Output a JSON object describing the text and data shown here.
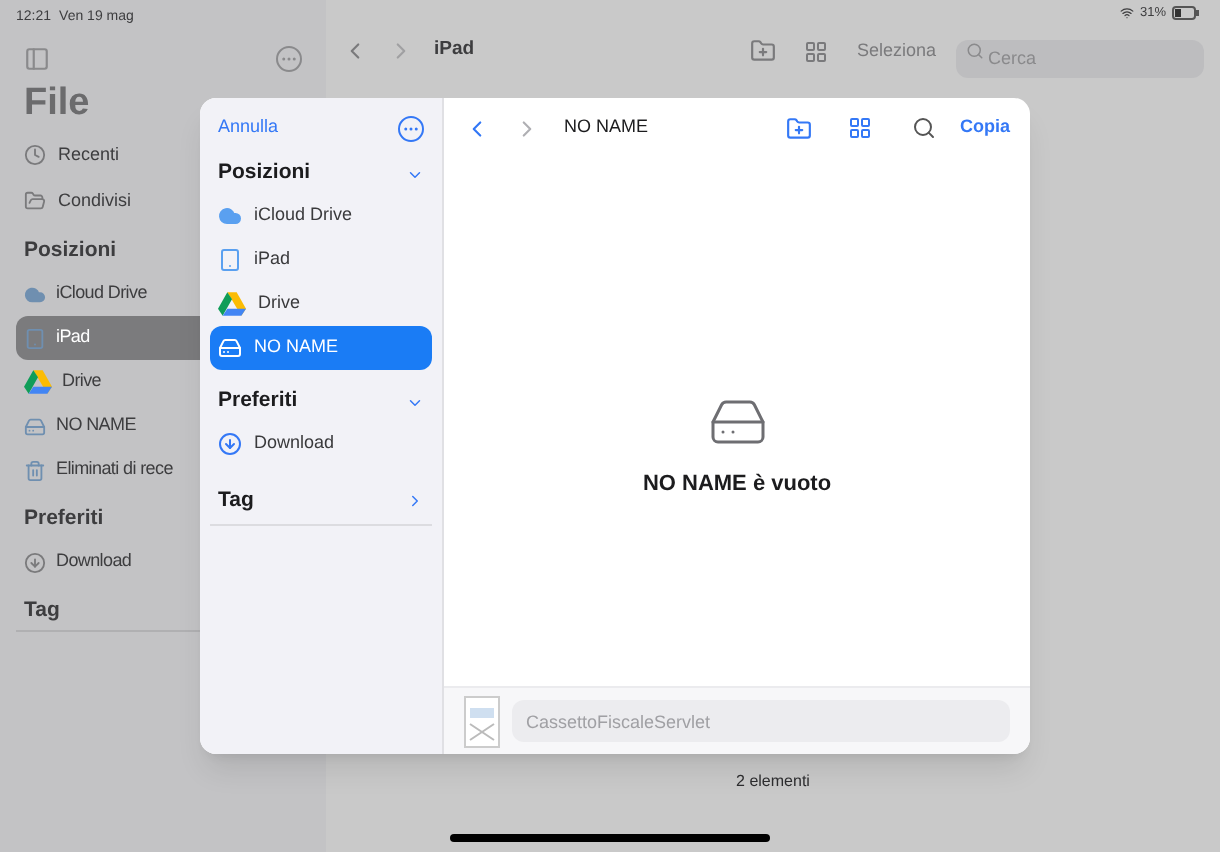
{
  "status_bar": {
    "time": "12:21",
    "date": "Ven 19 mag",
    "battery": "31%"
  },
  "sidebar": {
    "title": "File",
    "top_items": [
      {
        "label": "Recenti"
      },
      {
        "label": "Condivisi"
      }
    ],
    "sections": [
      {
        "title": "Posizioni",
        "items": [
          {
            "label": "iCloud Drive",
            "selected": false
          },
          {
            "label": "iPad",
            "selected": true
          },
          {
            "label": "Drive",
            "selected": false
          },
          {
            "label": "NO NAME",
            "selected": false
          },
          {
            "label": "Eliminati di rece",
            "selected": false
          }
        ]
      },
      {
        "title": "Preferiti",
        "items": [
          {
            "label": "Download",
            "selected": false
          }
        ]
      },
      {
        "title": "Tag"
      }
    ]
  },
  "main": {
    "title": "iPad",
    "select_label": "Seleziona",
    "search": {
      "placeholder": "Cerca"
    },
    "footer": "2 elementi"
  },
  "dialog": {
    "cancel": "Annulla",
    "sections": [
      {
        "title": "Posizioni",
        "expanded": true,
        "items": [
          {
            "label": "iCloud Drive",
            "selected": false
          },
          {
            "label": "iPad",
            "selected": false
          },
          {
            "label": "Drive",
            "selected": false
          },
          {
            "label": "NO NAME",
            "selected": true
          }
        ]
      },
      {
        "title": "Preferiti",
        "expanded": true,
        "items": [
          {
            "label": "Download",
            "selected": false
          }
        ]
      },
      {
        "title": "Tag",
        "expanded": false
      }
    ],
    "title": "NO NAME",
    "action": "Copia",
    "empty_message": "NO NAME è vuoto",
    "file_name": "CassettoFiscaleServlet"
  }
}
